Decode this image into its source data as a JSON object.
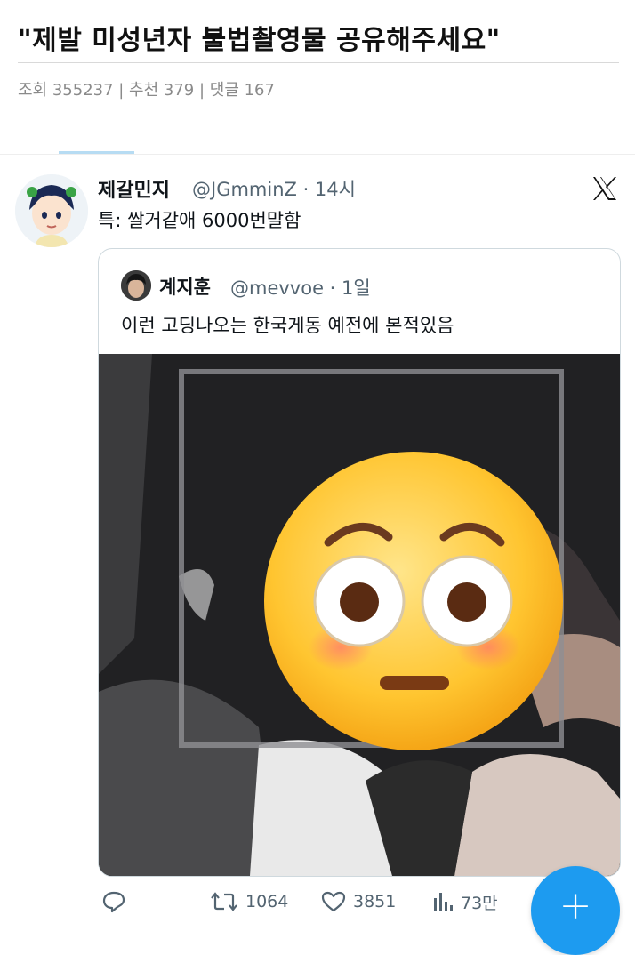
{
  "post": {
    "title": "\"제발 미성년자 불법촬영물 공유해주세요\"",
    "stats": "조회 355237 | 추천 379 | 댓글 167"
  },
  "tweet": {
    "author_name": "제갈민지",
    "author_handle_time": "@JGmminZ · 14시",
    "text": "특: 쌀거같애 6000번말함",
    "logo": "x-logo-icon",
    "quote": {
      "author_name": "계지훈",
      "author_handle_time": "@mevvoe · 1일",
      "text": "이런 고딩나오는 한국게동 예전에 본적있음",
      "media_overlay": "flushed-face-emoji"
    },
    "actions": {
      "reply_icon": "reply-icon",
      "retweets": "1064",
      "likes": "3851",
      "views": "73만"
    }
  },
  "fab": {
    "label": "+",
    "color": "#1d9bf0"
  },
  "colors": {
    "accent": "#1d9bf0",
    "muted": "#536471",
    "text": "#0f1419"
  }
}
